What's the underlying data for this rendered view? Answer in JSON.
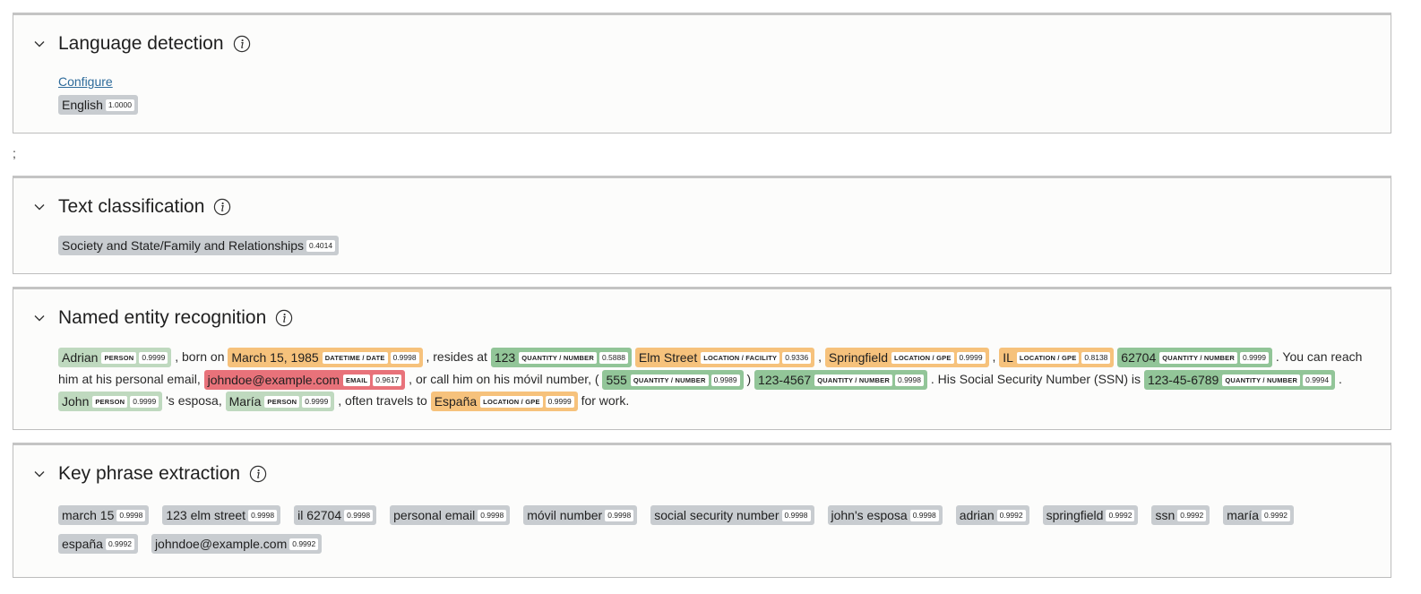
{
  "panels": {
    "language": {
      "title": "Language detection",
      "configure_label": "Configure",
      "result": {
        "label": "English",
        "score": "1.0000"
      }
    },
    "separator": ";",
    "classification": {
      "title": "Text classification",
      "result": {
        "label": "Society and State/Family and Relationships",
        "score": "0.4014"
      }
    },
    "ner": {
      "title": "Named entity recognition",
      "segments": [
        {
          "entity": "Adrian",
          "type": "PERSON",
          "score": "0.9999",
          "cls": "person"
        },
        {
          "text": ", born on"
        },
        {
          "entity": "March 15, 1985",
          "type": "DATETIME / DATE",
          "score": "0.9998",
          "cls": "date"
        },
        {
          "text": ", resides at"
        },
        {
          "entity": "123",
          "type": "QUANTITY / NUMBER",
          "score": "0.5888",
          "cls": "num"
        },
        {
          "entity": "Elm Street",
          "type": "LOCATION / FACILITY",
          "score": "0.9336",
          "cls": "loc"
        },
        {
          "text": ","
        },
        {
          "entity": "Springfield",
          "type": "LOCATION / GPE",
          "score": "0.9999",
          "cls": "loc"
        },
        {
          "text": ","
        },
        {
          "entity": "IL",
          "type": "LOCATION / GPE",
          "score": "0.8138",
          "cls": "loc"
        },
        {
          "entity": "62704",
          "type": "QUANTITY / NUMBER",
          "score": "0.9999",
          "cls": "num"
        },
        {
          "text": ". You can reach him at his personal email,"
        },
        {
          "entity": "johndoe@example.com",
          "type": "EMAIL",
          "score": "0.9617",
          "cls": "email"
        },
        {
          "text": ", or call him on his móvil number, ("
        },
        {
          "entity": "555",
          "type": "QUANTITY / NUMBER",
          "score": "0.9989",
          "cls": "num"
        },
        {
          "text": ")"
        },
        {
          "entity": "123-4567",
          "type": "QUANTITY / NUMBER",
          "score": "0.9998",
          "cls": "num"
        },
        {
          "text": ". His Social Security Number (SSN) is"
        },
        {
          "entity": "123-45-6789",
          "type": "QUANTITY / NUMBER",
          "score": "0.9994",
          "cls": "num"
        },
        {
          "text": "."
        },
        {
          "entity": "John",
          "type": "PERSON",
          "score": "0.9999",
          "cls": "person"
        },
        {
          "text": "'s esposa,"
        },
        {
          "entity": "María",
          "type": "PERSON",
          "score": "0.9999",
          "cls": "person"
        },
        {
          "text": ", often travels to"
        },
        {
          "entity": "España",
          "type": "LOCATION / GPE",
          "score": "0.9999",
          "cls": "loc"
        },
        {
          "text": "for work."
        }
      ]
    },
    "keyphrases": {
      "title": "Key phrase extraction",
      "items": [
        {
          "label": "march 15",
          "score": "0.9998"
        },
        {
          "label": "123 elm street",
          "score": "0.9998"
        },
        {
          "label": "il 62704",
          "score": "0.9998"
        },
        {
          "label": "personal email",
          "score": "0.9998"
        },
        {
          "label": "móvil number",
          "score": "0.9998"
        },
        {
          "label": "social security number",
          "score": "0.9998"
        },
        {
          "label": "john's esposa",
          "score": "0.9998"
        },
        {
          "label": "adrian",
          "score": "0.9992"
        },
        {
          "label": "springfield",
          "score": "0.9992"
        },
        {
          "label": "ssn",
          "score": "0.9992"
        },
        {
          "label": "maría",
          "score": "0.9992"
        },
        {
          "label": "españa",
          "score": "0.9992"
        },
        {
          "label": "johndoe@example.com",
          "score": "0.9992"
        }
      ]
    }
  },
  "icons": {
    "collapse": "chevron-down-icon",
    "info": "info-icon"
  }
}
